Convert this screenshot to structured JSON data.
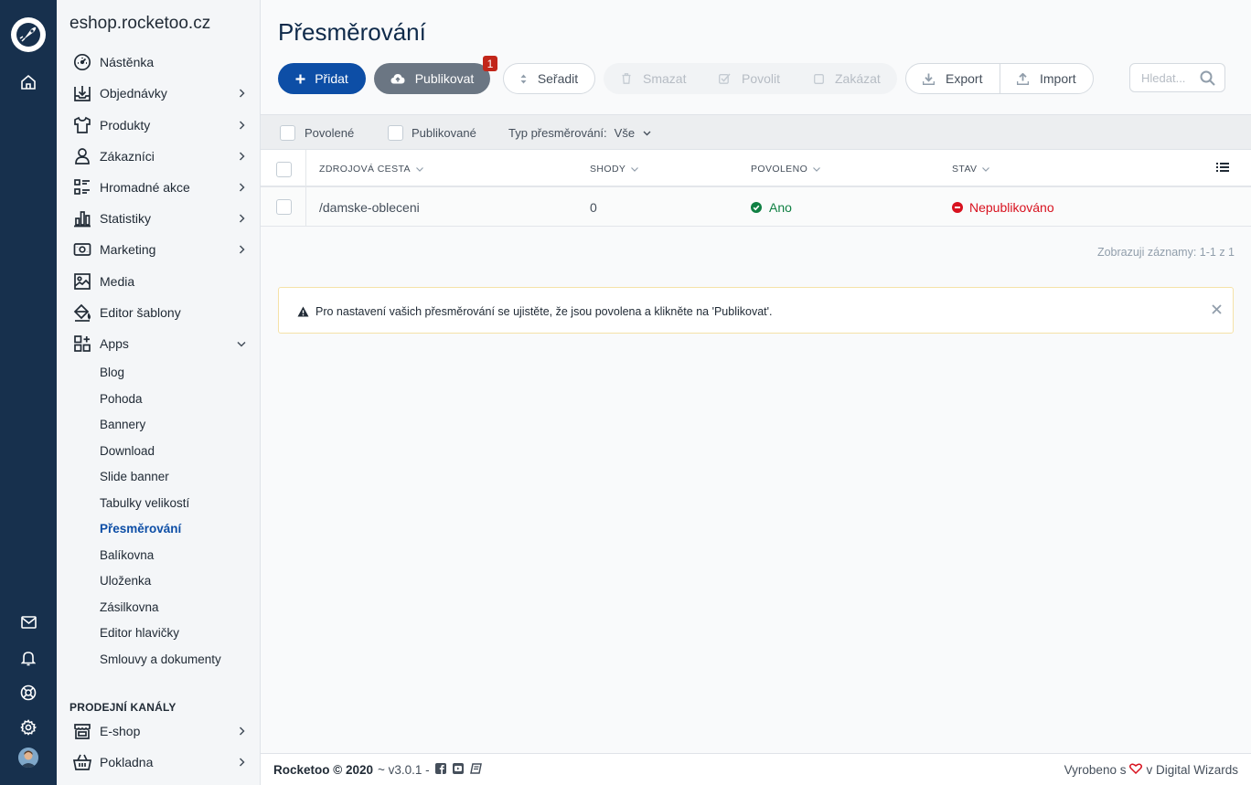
{
  "shop_name": "eshop.rocketoo.cz",
  "nav": [
    {
      "label": "Nástěnka"
    },
    {
      "label": "Objednávky"
    },
    {
      "label": "Produkty"
    },
    {
      "label": "Zákazníci"
    },
    {
      "label": "Hromadné akce"
    },
    {
      "label": "Statistiky"
    },
    {
      "label": "Marketing"
    },
    {
      "label": "Media"
    },
    {
      "label": "Editor šablony"
    },
    {
      "label": "Apps"
    }
  ],
  "apps_sub": [
    "Blog",
    "Pohoda",
    "Bannery",
    "Download",
    "Slide banner",
    "Tabulky velikostí",
    "Přesměrování",
    "Balíkovna",
    "Uloženka",
    "Zásilkovna",
    "Editor hlavičky",
    "Smlouvy a dokumenty"
  ],
  "sales_channels": {
    "title": "PRODEJNÍ KANÁLY",
    "items": [
      {
        "label": "E-shop"
      },
      {
        "label": "Pokladna"
      }
    ]
  },
  "page": {
    "title": "Přesměrování"
  },
  "toolbar": {
    "add": "Přidat",
    "publish": "Publikovat",
    "publish_badge": "1",
    "sort": "Seřadit",
    "delete": "Smazat",
    "enable": "Povolit",
    "disable": "Zakázat",
    "export": "Export",
    "import": "Import",
    "search_placeholder": "Hledat..."
  },
  "filters": {
    "enabled": "Povolené",
    "published": "Publikované",
    "type_label": "Typ přesměrování:",
    "type_value": "Vše"
  },
  "table": {
    "columns": [
      "ZDROJOVÁ CESTA",
      "SHODY",
      "POVOLENO",
      "STAV"
    ],
    "rows": [
      {
        "source": "/damske-obleceni",
        "matches": "0",
        "enabled": "Ano",
        "status": "Nepublikováno"
      }
    ]
  },
  "records_text": "Zobrazuji záznamy: 1-1 z 1",
  "alert": {
    "text": "Pro nastavení vašich přesměrování se ujistěte, že jsou povolena a klikněte na 'Publikovat'."
  },
  "footer": {
    "brand": "Rocketoo © 2020",
    "version": "~ v3.0.1 -",
    "made_with_prefix": "Vyrobeno s",
    "made_with_suffix": "v Digital Wizards"
  },
  "colors": {
    "rail": "#17304d",
    "primary": "#0d4ea6",
    "success": "#108043",
    "danger": "#d8121f",
    "badge": "#c2261a"
  }
}
